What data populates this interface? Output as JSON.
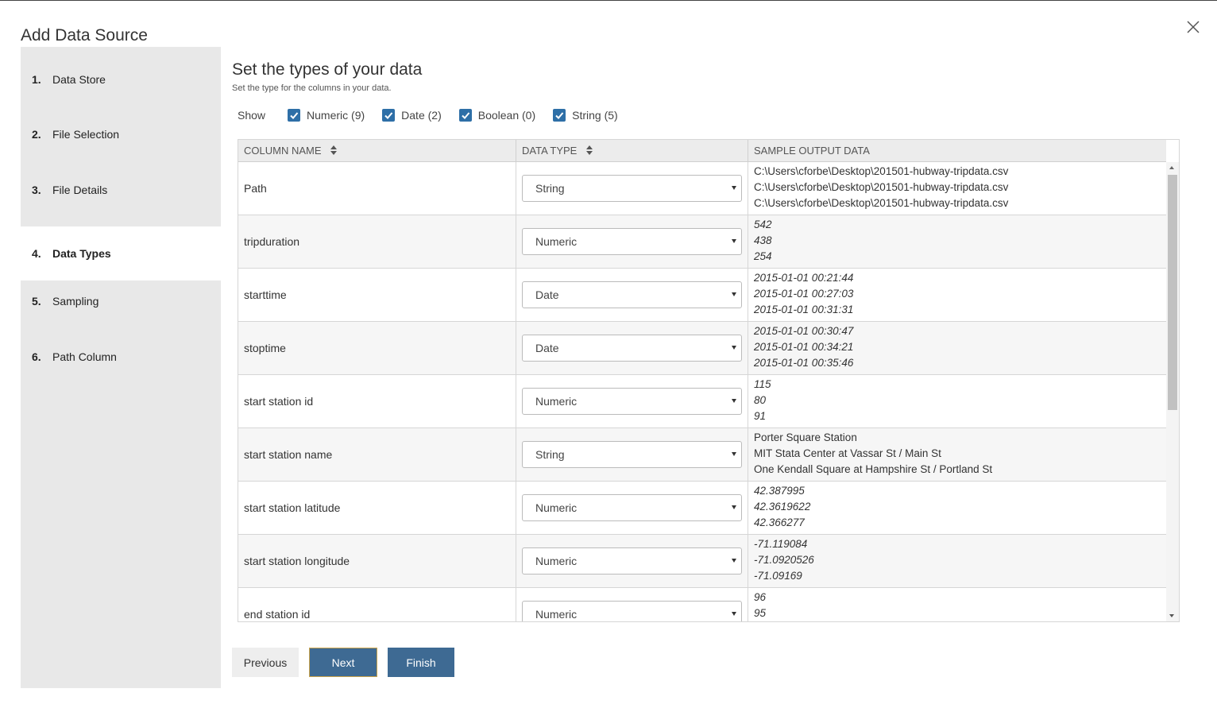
{
  "dialog": {
    "title": "Add Data Source"
  },
  "steps": [
    {
      "num": "1.",
      "label": "Data Store"
    },
    {
      "num": "2.",
      "label": "File Selection"
    },
    {
      "num": "3.",
      "label": "File Details"
    },
    {
      "num": "4.",
      "label": "Data Types",
      "active": true
    },
    {
      "num": "5.",
      "label": "Sampling"
    },
    {
      "num": "6.",
      "label": "Path Column"
    }
  ],
  "main": {
    "heading": "Set the types of your data",
    "subheading": "Set the type for the columns in your data."
  },
  "filters": {
    "show_label": "Show",
    "items": [
      {
        "label": "Numeric (9)",
        "checked": true
      },
      {
        "label": "Date (2)",
        "checked": true
      },
      {
        "label": "Boolean (0)",
        "checked": true
      },
      {
        "label": "String (5)",
        "checked": true
      }
    ]
  },
  "grid": {
    "headers": [
      "COLUMN NAME",
      "DATA TYPE",
      "SAMPLE OUTPUT DATA"
    ],
    "rows": [
      {
        "name": "Path",
        "type": "String",
        "samples": [
          "C:\\Users\\cforbe\\Desktop\\201501-hubway-tripdata.csv",
          "C:\\Users\\cforbe\\Desktop\\201501-hubway-tripdata.csv",
          "C:\\Users\\cforbe\\Desktop\\201501-hubway-tripdata.csv"
        ],
        "italic": false
      },
      {
        "name": "tripduration",
        "type": "Numeric",
        "samples": [
          "542",
          "438",
          "254"
        ],
        "italic": true
      },
      {
        "name": "starttime",
        "type": "Date",
        "samples": [
          "2015-01-01 00:21:44",
          "2015-01-01 00:27:03",
          "2015-01-01 00:31:31"
        ],
        "italic": true
      },
      {
        "name": "stoptime",
        "type": "Date",
        "samples": [
          "2015-01-01 00:30:47",
          "2015-01-01 00:34:21",
          "2015-01-01 00:35:46"
        ],
        "italic": true
      },
      {
        "name": "start station id",
        "type": "Numeric",
        "samples": [
          "115",
          "80",
          "91"
        ],
        "italic": true
      },
      {
        "name": "start station name",
        "type": "String",
        "samples": [
          "Porter Square Station",
          "MIT Stata Center at Vassar St / Main St",
          "One Kendall Square at Hampshire St / Portland St"
        ],
        "italic": false
      },
      {
        "name": "start station latitude",
        "type": "Numeric",
        "samples": [
          "42.387995",
          "42.3619622",
          "42.366277"
        ],
        "italic": true
      },
      {
        "name": "start station longitude",
        "type": "Numeric",
        "samples": [
          "-71.119084",
          "-71.0920526",
          "-71.09169"
        ],
        "italic": true
      },
      {
        "name": "end station id",
        "type": "Numeric",
        "samples": [
          "96",
          "95"
        ],
        "italic": true
      }
    ]
  },
  "buttons": {
    "previous": "Previous",
    "next": "Next",
    "finish": "Finish"
  },
  "colors": {
    "primary": "#3e6a93",
    "checkbox": "#2e6fa7",
    "sidebar": "#e8e8e8"
  }
}
